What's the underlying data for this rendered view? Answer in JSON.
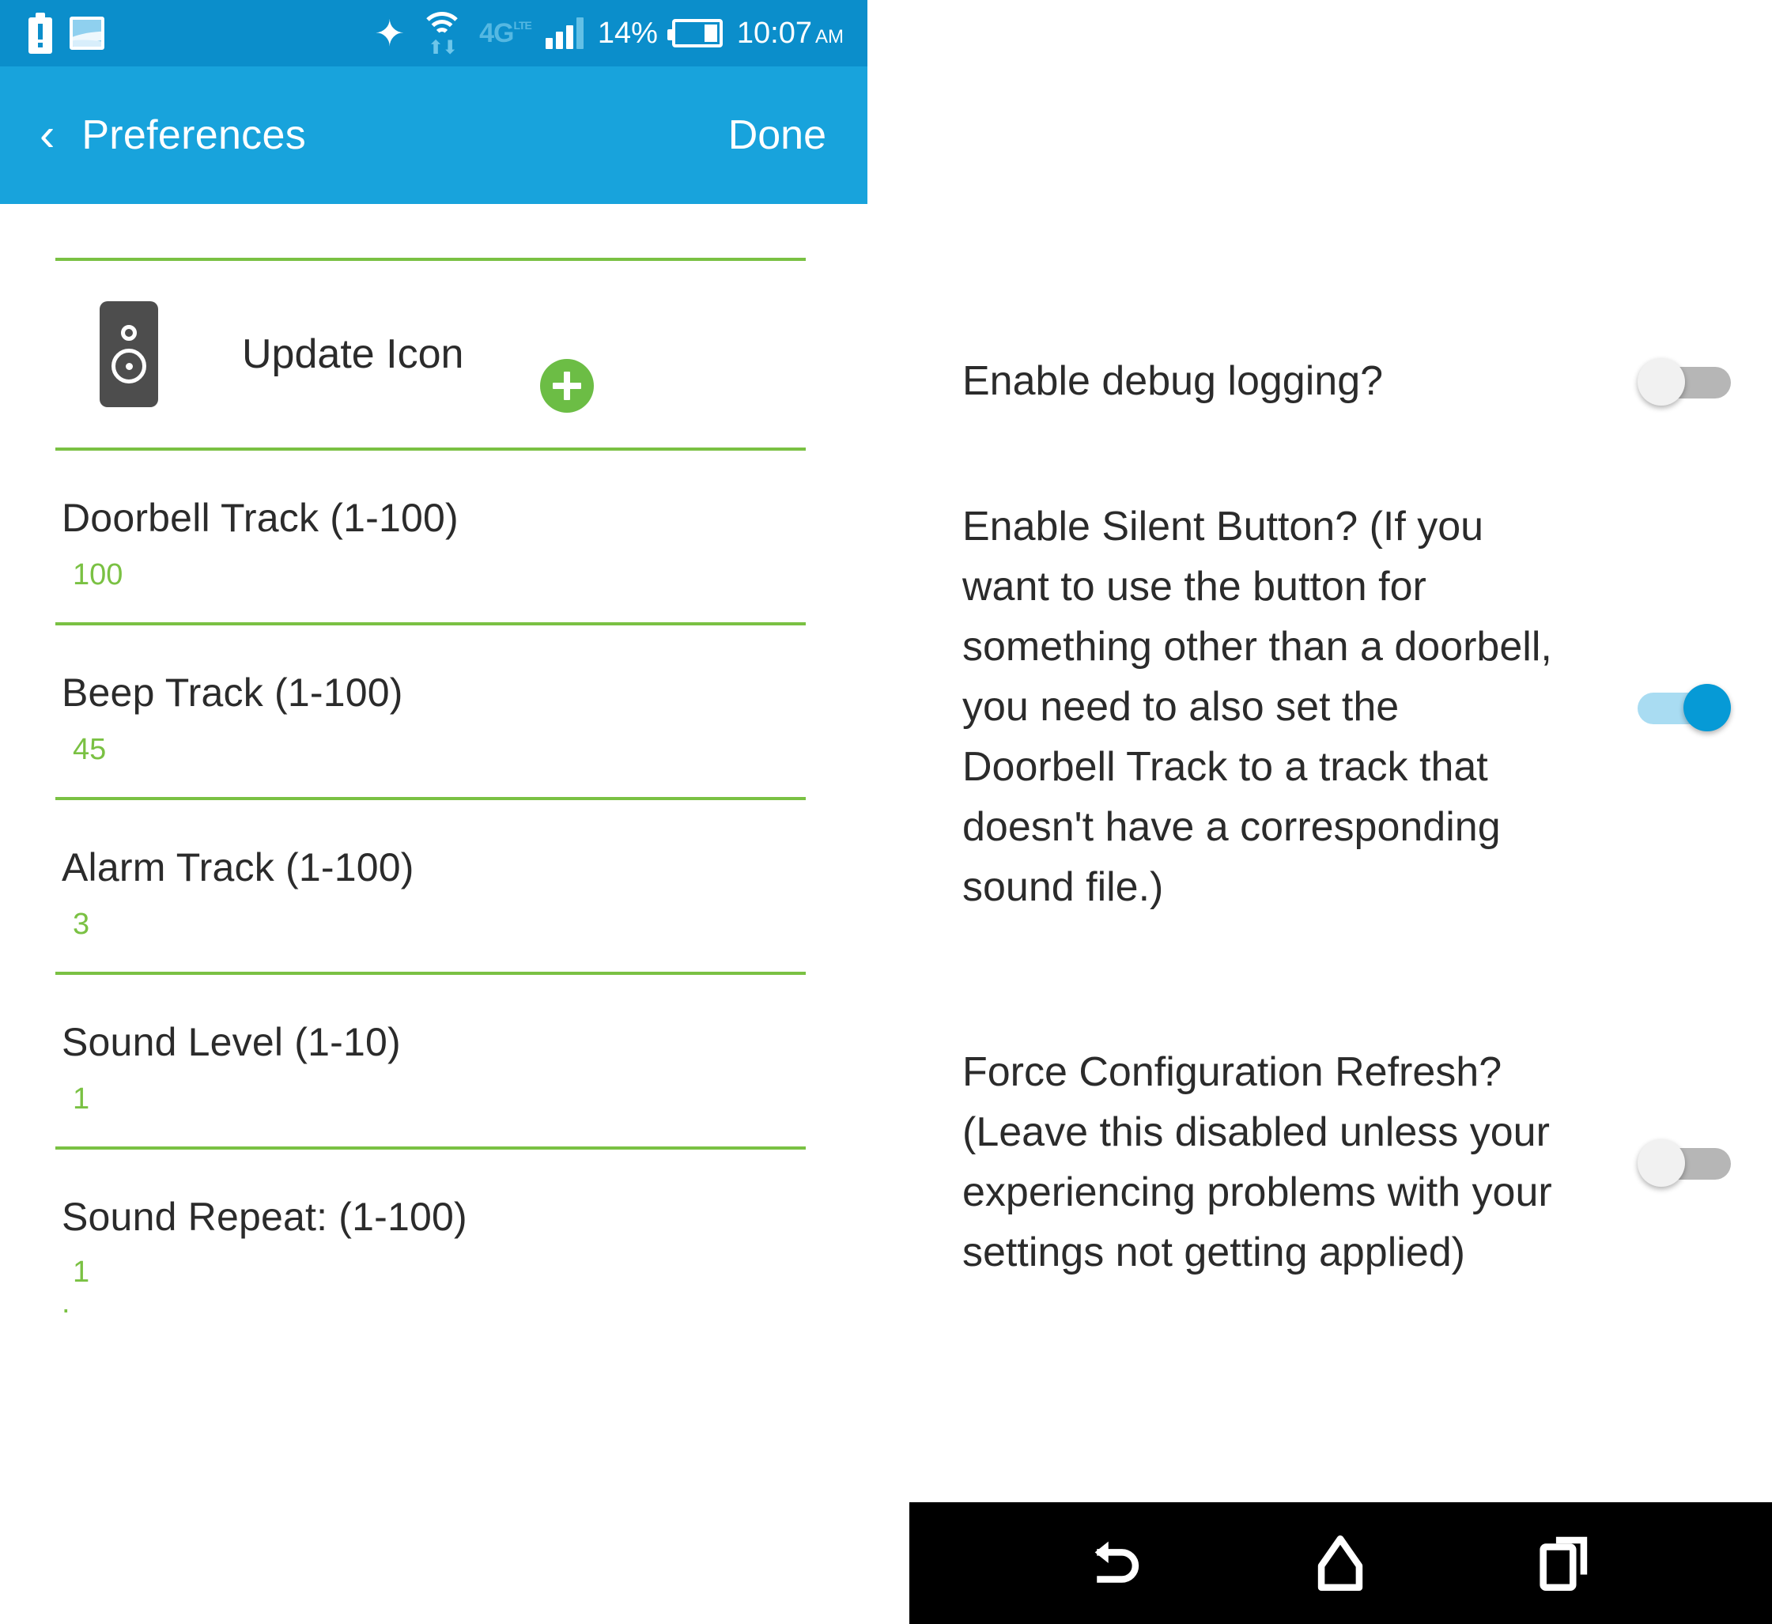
{
  "status_bar": {
    "battery_alert_icon": "battery-alert-icon",
    "photo_icon": "photo-icon",
    "bluetooth_icon": "bluetooth-icon",
    "wifi_icon": "wifi-icon",
    "network_label": "4G",
    "network_sub": "LTE",
    "signal_icon": "signal-bars-icon",
    "battery_percent": "14%",
    "battery_icon": "battery-icon",
    "time": "10:07",
    "time_meridiem": "AM"
  },
  "app_bar": {
    "back_icon": "chevron-left-icon",
    "title": "Preferences",
    "done_label": "Done"
  },
  "left_panel": {
    "clipped_row_text": "",
    "icon_row": {
      "speaker_icon": "speaker-icon",
      "label": "Update Icon",
      "add_icon": "plus-icon"
    },
    "fields": [
      {
        "label": "Doorbell Track (1-100)",
        "value": "100"
      },
      {
        "label": "Beep Track (1-100)",
        "value": "45"
      },
      {
        "label": "Alarm Track (1-100)",
        "value": "3"
      },
      {
        "label": "Sound Level (1-10)",
        "value": "1"
      },
      {
        "label": "Sound Repeat: (1-100)",
        "value": "1"
      }
    ],
    "trailing_mark": "."
  },
  "right_panel": {
    "preferences": [
      {
        "label": "Enable debug logging?",
        "toggle_state": "off"
      },
      {
        "label": "Enable Silent Button? (If you want to use the button for something other than a doorbell, you need to also set the Doorbell Track to a track that doesn't have a corresponding sound file.)",
        "toggle_state": "on"
      },
      {
        "label": "Force Configuration Refresh? (Leave this disabled unless your experiencing problems with your settings not getting applied)",
        "toggle_state": "off"
      }
    ]
  },
  "nav_bar": {
    "back_icon": "back-arrow-icon",
    "home_icon": "home-icon",
    "recents_icon": "recent-apps-icon"
  },
  "colors": {
    "status_bar": "#0b8ecb",
    "app_bar": "#18a3dc",
    "accent_green": "#7ac143",
    "toggle_on": "#069ad6",
    "toggle_on_track": "#a9dcf2",
    "toggle_off": "#b6b6b6",
    "text": "#2b2b2b",
    "nav_bar": "#000000"
  }
}
